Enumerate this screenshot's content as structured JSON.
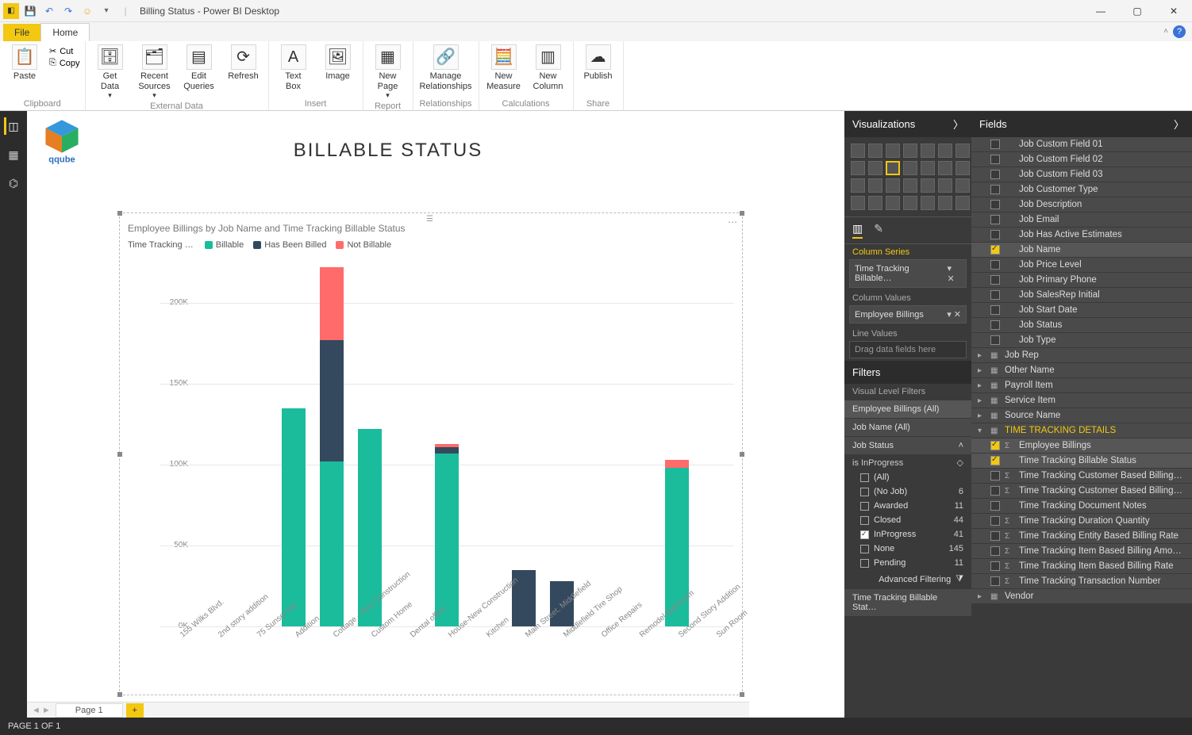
{
  "window": {
    "title": "Billing Status - Power BI Desktop"
  },
  "ribbon": {
    "tabs": {
      "file": "File",
      "home": "Home"
    },
    "groups": {
      "clipboard": {
        "label": "Clipboard",
        "paste": "Paste",
        "cut": "Cut",
        "copy": "Copy"
      },
      "external": {
        "label": "External Data",
        "getdata": "Get\nData",
        "recent": "Recent\nSources",
        "editq": "Edit\nQueries",
        "refresh": "Refresh"
      },
      "insert": {
        "label": "Insert",
        "textbox": "Text\nBox",
        "image": "Image"
      },
      "report": {
        "label": "Report",
        "newpage": "New\nPage"
      },
      "relationships": {
        "label": "Relationships",
        "manage": "Manage\nRelationships"
      },
      "calculations": {
        "label": "Calculations",
        "newmeasure": "New\nMeasure",
        "newcolumn": "New\nColumn"
      },
      "share": {
        "label": "Share",
        "publish": "Publish"
      }
    }
  },
  "report": {
    "title": "BILLABLE STATUS",
    "chart_title": "Employee Billings by Job Name and Time Tracking Billable Status",
    "legend_label": "Time Tracking …",
    "legend": [
      {
        "name": "Billable",
        "color": "#1abc9c"
      },
      {
        "name": "Has Been Billed",
        "color": "#34495e"
      },
      {
        "name": "Not Billable",
        "color": "#ff6b6b"
      }
    ]
  },
  "page_tab": "Page 1",
  "status": "PAGE 1 OF 1",
  "viz": {
    "title": "Visualizations",
    "column_series_label": "Column Series",
    "column_series": "Time Tracking Billable…",
    "column_values_label": "Column Values",
    "column_values": "Employee Billings",
    "line_values_label": "Line Values",
    "line_values_placeholder": "Drag data fields here",
    "filters_title": "Filters",
    "visual_filters_label": "Visual Level Filters",
    "filter1": "Employee Billings (All)",
    "filter2": "Job Name (All)",
    "filter3": "Job Status",
    "filter3_sub": "is InProgress",
    "filter_options": [
      {
        "label": "(All)",
        "count": "",
        "checked": false
      },
      {
        "label": "(No Job)",
        "count": "6",
        "checked": false
      },
      {
        "label": "Awarded",
        "count": "11",
        "checked": false
      },
      {
        "label": "Closed",
        "count": "44",
        "checked": false
      },
      {
        "label": "InProgress",
        "count": "41",
        "checked": true
      },
      {
        "label": "None",
        "count": "145",
        "checked": false
      },
      {
        "label": "Pending",
        "count": "11",
        "checked": false
      }
    ],
    "advanced": "Advanced Filtering",
    "filter4": "Time Tracking Billable Stat…"
  },
  "fields": {
    "title": "Fields",
    "items": [
      {
        "name": "Job Custom Field 01",
        "checked": false
      },
      {
        "name": "Job Custom Field 02",
        "checked": false
      },
      {
        "name": "Job Custom Field 03",
        "checked": false
      },
      {
        "name": "Job Customer Type",
        "checked": false
      },
      {
        "name": "Job Description",
        "checked": false
      },
      {
        "name": "Job Email",
        "checked": false
      },
      {
        "name": "Job Has Active Estimates",
        "checked": false
      },
      {
        "name": "Job Name",
        "checked": true
      },
      {
        "name": "Job Price Level",
        "checked": false
      },
      {
        "name": "Job Primary Phone",
        "checked": false
      },
      {
        "name": "Job SalesRep Initial",
        "checked": false
      },
      {
        "name": "Job Start Date",
        "checked": false
      },
      {
        "name": "Job Status",
        "checked": false
      },
      {
        "name": "Job Type",
        "checked": false
      }
    ],
    "tables": [
      {
        "name": "Job Rep"
      },
      {
        "name": "Other Name"
      },
      {
        "name": "Payroll Item"
      },
      {
        "name": "Service Item"
      },
      {
        "name": "Source Name"
      }
    ],
    "details_table": "TIME TRACKING DETAILS",
    "details": [
      {
        "name": "Employee Billings",
        "checked": true,
        "sigma": true
      },
      {
        "name": "Time Tracking Billable Status",
        "checked": true
      },
      {
        "name": "Time Tracking Customer Based Billing…",
        "checked": false,
        "sigma": true
      },
      {
        "name": "Time Tracking Customer Based Billing…",
        "checked": false,
        "sigma": true
      },
      {
        "name": "Time Tracking Document Notes",
        "checked": false
      },
      {
        "name": "Time Tracking Duration Quantity",
        "checked": false,
        "sigma": true
      },
      {
        "name": "Time Tracking Entity Based Billing Rate",
        "checked": false,
        "sigma": true
      },
      {
        "name": "Time Tracking Item Based Billing Amou…",
        "checked": false,
        "sigma": true
      },
      {
        "name": "Time Tracking Item Based Billing Rate",
        "checked": false,
        "sigma": true
      },
      {
        "name": "Time Tracking Transaction Number",
        "checked": false,
        "sigma": true
      }
    ],
    "vendor": "Vendor"
  },
  "chart_data": {
    "type": "bar",
    "stacked": true,
    "title": "Employee Billings by Job Name and Time Tracking Billable Status",
    "xlabel": "Job Name",
    "ylabel": "Employee Billings",
    "ylim": [
      0,
      230000
    ],
    "yticks": [
      0,
      50000,
      100000,
      150000,
      200000
    ],
    "ytick_labels": [
      "0K",
      "50K",
      "100K",
      "150K",
      "200K"
    ],
    "categories": [
      "155 Wilks Blvd.",
      "2nd story addition",
      "75 Sunset Rd.",
      "Addition",
      "Cottage - New Construction",
      "Custom Home",
      "Dental office",
      "House-New Construction",
      "Kitchen",
      "Main Street, Middlefield",
      "Middlefield Tire Shop",
      "Office Repairs",
      "Remodel Bathroom",
      "Second Story Addition",
      "Sun Room"
    ],
    "series": [
      {
        "name": "Billable",
        "color": "#1abc9c",
        "values": [
          0,
          0,
          0,
          135000,
          102000,
          122000,
          0,
          107000,
          0,
          0,
          0,
          0,
          0,
          98000,
          0
        ]
      },
      {
        "name": "Has Been Billed",
        "color": "#34495e",
        "values": [
          0,
          0,
          0,
          0,
          75000,
          0,
          0,
          4000,
          0,
          35000,
          28000,
          0,
          0,
          0,
          0
        ]
      },
      {
        "name": "Not Billable",
        "color": "#ff6b6b",
        "values": [
          0,
          0,
          0,
          0,
          45000,
          0,
          0,
          2000,
          0,
          0,
          0,
          0,
          0,
          5000,
          0
        ]
      }
    ]
  }
}
